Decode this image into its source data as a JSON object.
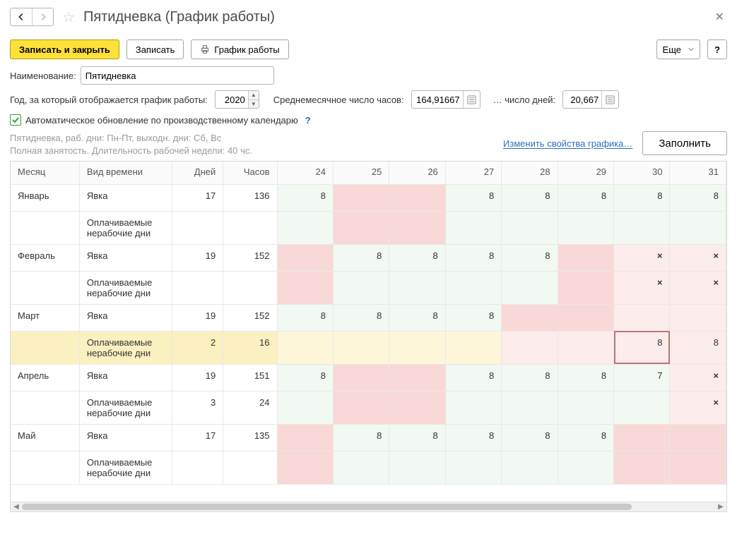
{
  "title": "Пятидневка (График работы)",
  "toolbar": {
    "write_close": "Записать и закрыть",
    "write": "Записать",
    "schedule": "График работы",
    "more": "Еще",
    "help": "?"
  },
  "form": {
    "name_label": "Наименование:",
    "name_value": "Пятидневка",
    "year_label": "Год, за который отображается график работы:",
    "year_value": "2020",
    "avg_hours_label": "Среднемесячное число часов:",
    "avg_hours_value": "164,91667",
    "avg_days_label": "… число дней:",
    "avg_days_value": "20,667",
    "auto_update_label": "Автоматическое обновление по производственному календарю",
    "info1": "Пятидневка, раб. дни: Пн-Пт, выходн. дни: Сб, Вс",
    "info2": "Полная занятость. Длительность рабочей недели: 40 чс.",
    "change_props": "Изменить свойства графика…",
    "fill": "Заполнить"
  },
  "table": {
    "headers": {
      "month": "Месяц",
      "type": "Вид времени",
      "days": "Дней",
      "hours": "Часов",
      "d24": "24",
      "d25": "25",
      "d26": "26",
      "d27": "27",
      "d28": "28",
      "d29": "29",
      "d30": "30",
      "d31": "31"
    },
    "rows": [
      {
        "month": "Январь",
        "type": "Явка",
        "days": "17",
        "hours": "136",
        "cells": [
          {
            "v": "8",
            "c": "g"
          },
          {
            "v": "",
            "c": "p"
          },
          {
            "v": "",
            "c": "p"
          },
          {
            "v": "8",
            "c": "g"
          },
          {
            "v": "8",
            "c": "g"
          },
          {
            "v": "8",
            "c": "g"
          },
          {
            "v": "8",
            "c": "g"
          },
          {
            "v": "8",
            "c": "g"
          }
        ]
      },
      {
        "month": "",
        "type": "Оплачиваемые нерабочие дни",
        "days": "",
        "hours": "",
        "cells": [
          {
            "v": "",
            "c": "g"
          },
          {
            "v": "",
            "c": "p"
          },
          {
            "v": "",
            "c": "p"
          },
          {
            "v": "",
            "c": "g"
          },
          {
            "v": "",
            "c": "g"
          },
          {
            "v": "",
            "c": "g"
          },
          {
            "v": "",
            "c": "g"
          },
          {
            "v": "",
            "c": "g"
          }
        ]
      },
      {
        "month": "Февраль",
        "type": "Явка",
        "days": "19",
        "hours": "152",
        "cells": [
          {
            "v": "",
            "c": "p"
          },
          {
            "v": "8",
            "c": "g"
          },
          {
            "v": "8",
            "c": "g"
          },
          {
            "v": "8",
            "c": "g"
          },
          {
            "v": "8",
            "c": "g"
          },
          {
            "v": "",
            "c": "p"
          },
          {
            "v": "×",
            "c": "pl"
          },
          {
            "v": "×",
            "c": "pl"
          }
        ]
      },
      {
        "month": "",
        "type": "Оплачиваемые нерабочие дни",
        "days": "",
        "hours": "",
        "cells": [
          {
            "v": "",
            "c": "p"
          },
          {
            "v": "",
            "c": "g"
          },
          {
            "v": "",
            "c": "g"
          },
          {
            "v": "",
            "c": "g"
          },
          {
            "v": "",
            "c": "g"
          },
          {
            "v": "",
            "c": "p"
          },
          {
            "v": "×",
            "c": "pl"
          },
          {
            "v": "×",
            "c": "pl"
          }
        ]
      },
      {
        "month": "Март",
        "type": "Явка",
        "days": "19",
        "hours": "152",
        "cells": [
          {
            "v": "8",
            "c": "g"
          },
          {
            "v": "8",
            "c": "g"
          },
          {
            "v": "8",
            "c": "g"
          },
          {
            "v": "8",
            "c": "g"
          },
          {
            "v": "",
            "c": "p"
          },
          {
            "v": "",
            "c": "p"
          },
          {
            "v": "",
            "c": "pl"
          },
          {
            "v": "",
            "c": "pl"
          }
        ]
      },
      {
        "month": "",
        "type": "Оплачиваемые нерабочие дни",
        "days": "2",
        "hours": "16",
        "yellow": true,
        "cells": [
          {
            "v": "",
            "c": "yl"
          },
          {
            "v": "",
            "c": "yl"
          },
          {
            "v": "",
            "c": "yl"
          },
          {
            "v": "",
            "c": "yl"
          },
          {
            "v": "",
            "c": "pl"
          },
          {
            "v": "",
            "c": "pl"
          },
          {
            "v": "8",
            "c": "pl",
            "sel": true
          },
          {
            "v": "8",
            "c": "pl"
          }
        ]
      },
      {
        "month": "Апрель",
        "type": "Явка",
        "days": "19",
        "hours": "151",
        "cells": [
          {
            "v": "8",
            "c": "g"
          },
          {
            "v": "",
            "c": "p"
          },
          {
            "v": "",
            "c": "p"
          },
          {
            "v": "8",
            "c": "g"
          },
          {
            "v": "8",
            "c": "g"
          },
          {
            "v": "8",
            "c": "g"
          },
          {
            "v": "7",
            "c": "g"
          },
          {
            "v": "×",
            "c": "pl"
          }
        ]
      },
      {
        "month": "",
        "type": "Оплачиваемые нерабочие дни",
        "days": "3",
        "hours": "24",
        "cells": [
          {
            "v": "",
            "c": "g"
          },
          {
            "v": "",
            "c": "p"
          },
          {
            "v": "",
            "c": "p"
          },
          {
            "v": "",
            "c": "g"
          },
          {
            "v": "",
            "c": "g"
          },
          {
            "v": "",
            "c": "g"
          },
          {
            "v": "",
            "c": "g"
          },
          {
            "v": "×",
            "c": "pl"
          }
        ]
      },
      {
        "month": "Май",
        "type": "Явка",
        "days": "17",
        "hours": "135",
        "cells": [
          {
            "v": "",
            "c": "p"
          },
          {
            "v": "8",
            "c": "g"
          },
          {
            "v": "8",
            "c": "g"
          },
          {
            "v": "8",
            "c": "g"
          },
          {
            "v": "8",
            "c": "g"
          },
          {
            "v": "8",
            "c": "g"
          },
          {
            "v": "",
            "c": "p"
          },
          {
            "v": "",
            "c": "p"
          }
        ]
      },
      {
        "month": "",
        "type": "Оплачиваемые нерабочие дни",
        "days": "",
        "hours": "",
        "cells": [
          {
            "v": "",
            "c": "p"
          },
          {
            "v": "",
            "c": "g"
          },
          {
            "v": "",
            "c": "g"
          },
          {
            "v": "",
            "c": "g"
          },
          {
            "v": "",
            "c": "g"
          },
          {
            "v": "",
            "c": "g"
          },
          {
            "v": "",
            "c": "p"
          },
          {
            "v": "",
            "c": "p"
          }
        ]
      }
    ]
  }
}
